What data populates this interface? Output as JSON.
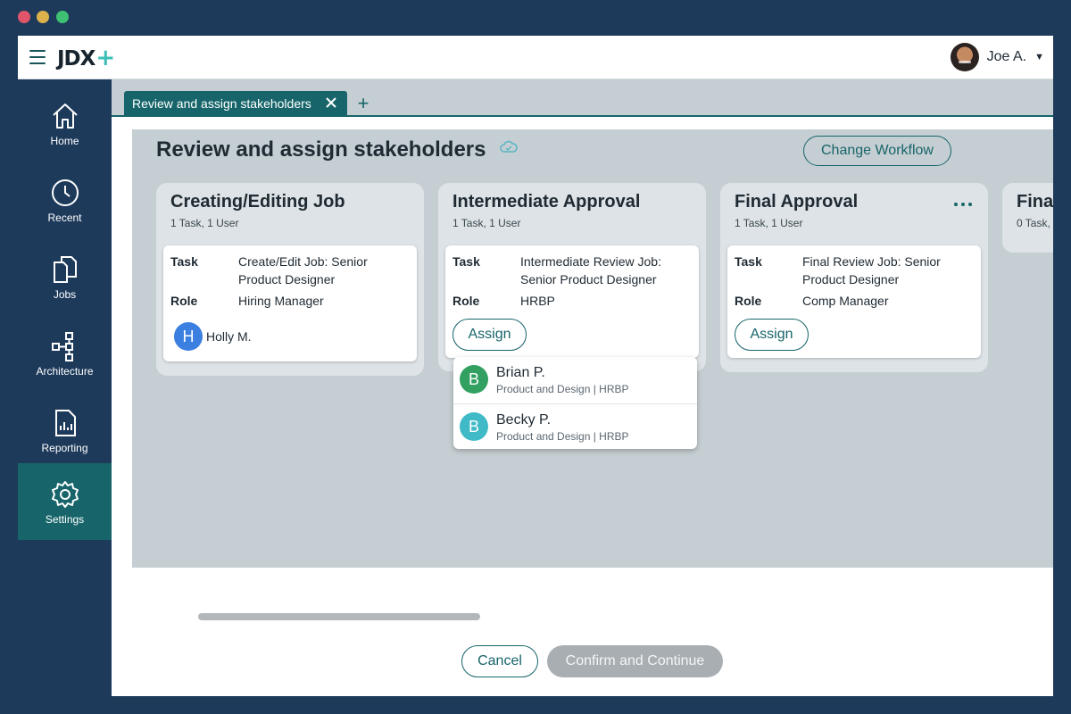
{
  "app": {
    "logo": "JDX",
    "logo_plus": "+"
  },
  "user": {
    "name": "Joe A."
  },
  "sidebar": {
    "items": [
      {
        "label": "Home",
        "icon": "home-icon"
      },
      {
        "label": "Recent",
        "icon": "clock-icon"
      },
      {
        "label": "Jobs",
        "icon": "documents-icon"
      },
      {
        "label": "Architecture",
        "icon": "hierarchy-icon"
      },
      {
        "label": "Reporting",
        "icon": "report-icon"
      },
      {
        "label": "Settings",
        "icon": "gear-icon",
        "active": true
      }
    ]
  },
  "tabs": [
    {
      "label": "Review and assign stakeholders"
    }
  ],
  "page": {
    "title": "Review and assign stakeholders",
    "change_workflow": "Change Workflow"
  },
  "columns": [
    {
      "title": "Creating/Editing Job",
      "subtitle": "1 Task, 1 User",
      "task_key": "Task",
      "task": "Create/Edit Job: Senior Product Designer",
      "role_key": "Role",
      "role": "Hiring Manager",
      "assignee": {
        "initial": "H",
        "name": "Holly M.",
        "color": "#3b7fe0"
      }
    },
    {
      "title": "Intermediate Approval",
      "subtitle": "1 Task, 1 User",
      "task_key": "Task",
      "task": "Intermediate Review Job: Senior Product Designer",
      "role_key": "Role",
      "role": "HRBP",
      "assign_label": "Assign"
    },
    {
      "title": "Final Approval",
      "subtitle": "1 Task, 1 User",
      "task_key": "Task",
      "task": "Final Review Job: Senior Product Designer",
      "role_key": "Role",
      "role": "Comp Manager",
      "assign_label": "Assign"
    },
    {
      "title": "Fina",
      "subtitle": "0 Task,"
    }
  ],
  "assign_dropdown": [
    {
      "initial": "B",
      "name": "Brian P.",
      "meta": "Product and Design | HRBP",
      "color": "#32a060"
    },
    {
      "initial": "B",
      "name": "Becky P.",
      "meta": "Product and Design | HRBP",
      "color": "#3fbac6"
    }
  ],
  "footer": {
    "cancel": "Cancel",
    "confirm": "Confirm and Continue"
  },
  "colors": {
    "accent": "#17656a",
    "sidebar": "#1e3a5b",
    "board": "#c5ced2",
    "disabled": "#a8aeb2"
  }
}
